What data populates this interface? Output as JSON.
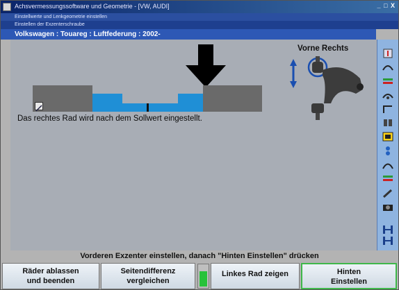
{
  "window": {
    "title": "Achsvermessungssoftware und Geometrie - [VW, AUDI]",
    "controls": "_ □ X"
  },
  "menubar": {
    "text": "Einstellwerte und Lenkgeometrie einstellen"
  },
  "subbar": {
    "text": "Einstellen der Exzenterschraube"
  },
  "vehicle": {
    "label": "Volkswagen : Touareg : Luftfederung : 2002-"
  },
  "gauge": {
    "instruction": "Das rechtes Rad wird nach dem Sollwert eingestellt."
  },
  "wheel": {
    "title": "Vorne Rechts"
  },
  "status": {
    "text": "Vorderen Exzenter einstellen, danach \"Hinten Einstellen\" drücken"
  },
  "buttons": {
    "b1_line1": "Räder ablassen",
    "b1_line2": "und beenden",
    "b2_line1": "Seitendifferenz",
    "b2_line2": "vergleichen",
    "b3": "Linkes Rad zeigen",
    "b4_line1": "Hinten",
    "b4_line2": "Einstellen"
  },
  "colors": {
    "accent_blue": "#1f8fd6",
    "title_bar": "#0a246a",
    "vehicle_bar": "#2d58b5",
    "indicator_green": "#27c23a"
  },
  "toolbar_icons": [
    "lift-icon",
    "caster-icon",
    "camber-icon",
    "toe-icon",
    "curve-icon",
    "wheel-adjust-icon",
    "steering-icon",
    "selected-tool-icon",
    "sensor-icon",
    "arch-icon",
    "alignment-icon",
    "tools-icon",
    "camera-icon",
    "axle-icon"
  ]
}
